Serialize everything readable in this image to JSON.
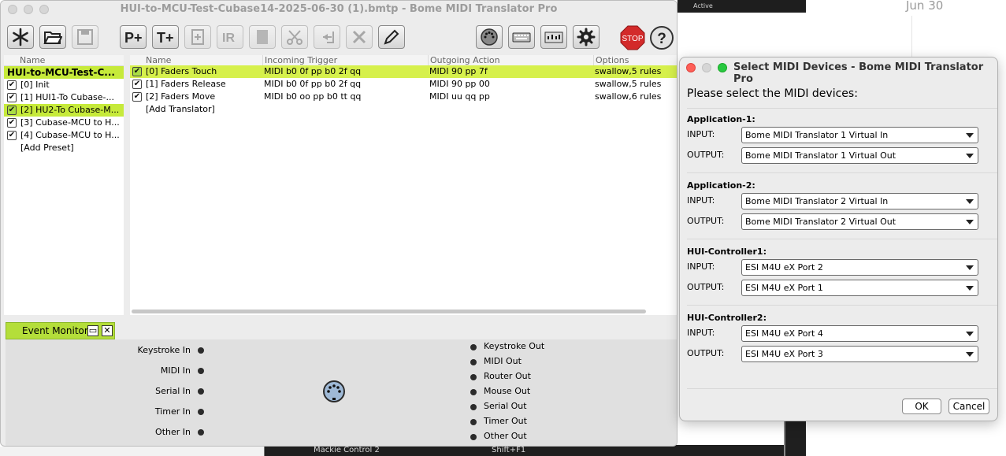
{
  "desktop": {
    "top_strip": {
      "active_label": "Active"
    },
    "date": "Jun 30",
    "bottom_bar": {
      "item_label": "Mackie Control 2",
      "shortcut": "Shift+F1"
    }
  },
  "main_window": {
    "title": "HUI-to-MCU-Test-Cubase14-2025-06-30 (1).bmtp - Bome MIDI Translator Pro",
    "toolbar": {
      "buttons": [
        {
          "icon": "asterisk-icon",
          "enabled": true
        },
        {
          "icon": "folder-open-icon",
          "enabled": true
        },
        {
          "icon": "save-icon",
          "enabled": false
        },
        {
          "icon": "add-preset-icon",
          "label": "P+",
          "enabled": true
        },
        {
          "icon": "add-translator-icon",
          "label": "T+",
          "enabled": true
        },
        {
          "icon": "duplicate-icon",
          "enabled": false
        },
        {
          "icon": "rename-icon",
          "label": "IR",
          "enabled": false
        },
        {
          "icon": "copy-icon",
          "enabled": false
        },
        {
          "icon": "cut-icon",
          "enabled": false
        },
        {
          "icon": "paste-icon",
          "enabled": false
        },
        {
          "icon": "delete-icon",
          "enabled": false
        },
        {
          "icon": "pencil-icon",
          "enabled": true
        },
        {
          "icon": "midi-port-icon",
          "enabled": true
        },
        {
          "icon": "keyboard-icon",
          "enabled": true
        },
        {
          "icon": "router-icon",
          "enabled": true
        },
        {
          "icon": "gear-icon",
          "enabled": true
        },
        {
          "icon": "stop-icon",
          "label": "STOP",
          "enabled": true
        },
        {
          "icon": "help-icon",
          "label": "?",
          "enabled": true
        }
      ]
    },
    "presets": {
      "header": "Name",
      "project_name": "HUI-to-MCU-Test-C...",
      "items": [
        {
          "label": "[0] Init",
          "checked": true
        },
        {
          "label": "[1] HUI1-To Cubase-...",
          "checked": true
        },
        {
          "label": "[2] HU2-To Cubase-M...",
          "checked": true,
          "selected": true
        },
        {
          "label": "[3] Cubase-MCU to H...",
          "checked": true
        },
        {
          "label": "[4] Cubase-MCU to H...",
          "checked": true
        }
      ],
      "add_label": "[Add Preset]"
    },
    "translators": {
      "columns": [
        "Name",
        "Incoming Trigger",
        "Outgoing Action",
        "Options"
      ],
      "rows": [
        {
          "name": "[0] Faders Touch",
          "incoming": "MIDI b0 0f pp b0 2f qq",
          "outgoing": "MIDI 90 pp 7f",
          "options": "swallow,5 rules",
          "selected": true
        },
        {
          "name": "[1] Faders Release",
          "incoming": "MIDI b0 0f pp b0 2f qq",
          "outgoing": "MIDI 90 pp 00",
          "options": "swallow,5 rules"
        },
        {
          "name": "[2] Faders Move",
          "incoming": "MIDI b0 oo pp b0 tt qq",
          "outgoing": "MIDI uu qq pp",
          "options": "swallow,6 rules"
        }
      ],
      "add_label": "[Add Translator]"
    },
    "event_monitor": {
      "title": "Event Monitor",
      "inputs": [
        "Keystroke In",
        "MIDI In",
        "Serial In",
        "Timer In",
        "Other In"
      ],
      "outputs": [
        "Keystroke Out",
        "MIDI Out",
        "Router Out",
        "Mouse Out",
        "Serial Out",
        "Timer Out",
        "Other Out"
      ]
    }
  },
  "dialog": {
    "title": "Select MIDI Devices - Bome MIDI Translator Pro",
    "heading": "Please select the MIDI devices:",
    "groups": [
      {
        "name": "Application-1:",
        "input_label": "INPUT:",
        "input_value": "Bome MIDI Translator 1 Virtual In",
        "output_label": "OUTPUT:",
        "output_value": "Bome MIDI Translator 1 Virtual Out"
      },
      {
        "name": "Application-2:",
        "input_label": "INPUT:",
        "input_value": "Bome MIDI Translator 2 Virtual In",
        "output_label": "OUTPUT:",
        "output_value": "Bome MIDI Translator 2 Virtual Out"
      },
      {
        "name": "HUI-Controller1:",
        "input_label": "INPUT:",
        "input_value": "ESI M4U eX Port 2",
        "output_label": "OUTPUT:",
        "output_value": "ESI M4U eX Port 1"
      },
      {
        "name": "HUI-Controller2:",
        "input_label": "INPUT:",
        "input_value": "ESI M4U eX Port 4",
        "output_label": "OUTPUT:",
        "output_value": "ESI M4U eX Port 3"
      }
    ],
    "ok_label": "OK",
    "cancel_label": "Cancel"
  },
  "colors": {
    "selection_green": "#c6ea3a",
    "translator_highlight": "#d6f04c",
    "stop_red": "#d32a2a",
    "traffic_red": "#fe5f57",
    "traffic_yellow": "#febc2e",
    "traffic_green": "#28c840"
  }
}
